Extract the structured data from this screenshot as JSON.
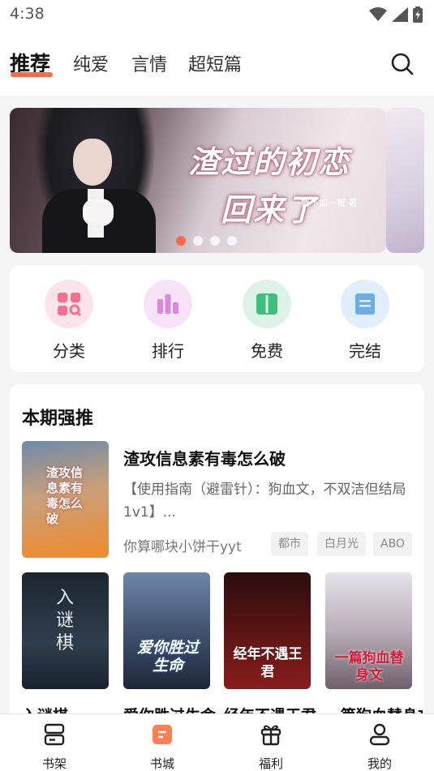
{
  "status_bar": {
    "time": "4:38"
  },
  "top_tabs": [
    {
      "label": "推荐"
    },
    {
      "label": "纯爱"
    },
    {
      "label": "言情"
    },
    {
      "label": "超短篇"
    }
  ],
  "banner": {
    "title_line1": "渣过的初恋",
    "title_line2": "回来了",
    "author": "一蟹不如一蟹 著"
  },
  "quick_entries": [
    {
      "label": "分类"
    },
    {
      "label": "排行"
    },
    {
      "label": "免费"
    },
    {
      "label": "完结"
    }
  ],
  "featured_section": {
    "title": "本期强推",
    "main_book": {
      "title": "渣攻信息素有毒怎么破",
      "description": "【使用指南（避雷针）：狗血文，不双洁但结局1v1】...",
      "author": "你算哪块小饼干yyt",
      "tags": [
        "都市",
        "白月光",
        "ABO"
      ],
      "cover_text": "渣攻信息素有毒怎么破"
    },
    "books": [
      {
        "title": "入谜棋",
        "cover_text": "入谜棋"
      },
      {
        "title": "爱你胜过生命",
        "cover_text": "爱你胜过生命"
      },
      {
        "title": "经年不遇王君",
        "cover_text": "经年不遇王君"
      },
      {
        "title": "一篇狗血替身文",
        "cover_text": "一篇狗血替身文"
      }
    ]
  },
  "bottom_nav": [
    {
      "label": "书架"
    },
    {
      "label": "书城"
    },
    {
      "label": "福利"
    },
    {
      "label": "我的"
    }
  ],
  "colors": {
    "accent": "#ff6a4d"
  }
}
